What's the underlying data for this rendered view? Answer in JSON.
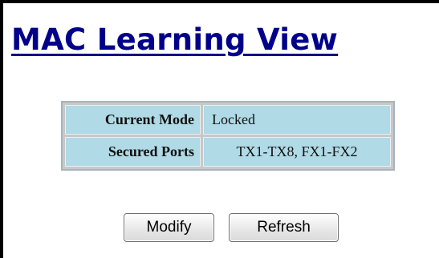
{
  "page": {
    "title": "MAC Learning View"
  },
  "mac_learning": {
    "rows": [
      {
        "label": "Current Mode",
        "value": "Locked"
      },
      {
        "label": "Secured Ports",
        "value": "TX1-TX8, FX1-FX2"
      }
    ]
  },
  "actions": {
    "modify_label": "Modify",
    "refresh_label": "Refresh"
  }
}
